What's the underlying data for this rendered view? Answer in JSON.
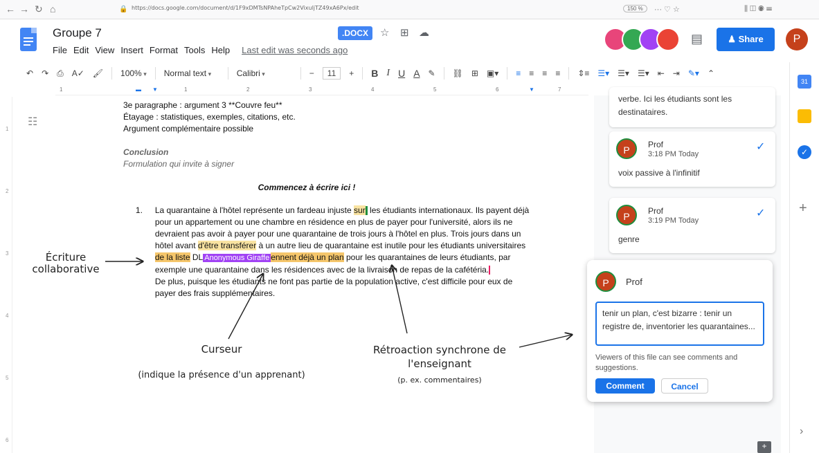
{
  "browser": {
    "url": "https://docs.google.com/document/d/1F9xDMTsNPAheTpCw2VixuljTZ49xA6Px/edit",
    "zoom": "150 %"
  },
  "header": {
    "title": "Groupe 7",
    "badge": ".DOCX",
    "menu": [
      "File",
      "Edit",
      "View",
      "Insert",
      "Format",
      "Tools",
      "Help"
    ],
    "last_edit": "Last edit was seconds ago",
    "share_label": "Share",
    "user_initial": "P"
  },
  "toolbar": {
    "zoom": "100%",
    "style": "Normal text",
    "font": "Calibri",
    "size": "11"
  },
  "ruler": [
    "1",
    "1",
    "2",
    "3",
    "4",
    "5",
    "6",
    "7"
  ],
  "vruler": [
    "1",
    "2",
    "3",
    "4",
    "5",
    "6"
  ],
  "doc": {
    "line1": "3e paragraphe : argument 3 **Couvre feu**",
    "line2": "Étayage : statistiques, exemples, citations, etc.",
    "line3": "Argument complémentaire possible",
    "conclusion": "Conclusion",
    "formulation": "Formulation qui invite à signer",
    "start_here": "Commencez à écrire ici !",
    "item_number": "1.",
    "p1_a": "La quarantaine à l'hôtel représente un fardeau injuste ",
    "p1_sur": "sur",
    "p1_b": " les étudiants internationaux. Ils payent déjà pour un appartement ou une chambre en résidence en plus de payer pour l'université, alors ils ne devraient pas avoir à payer pour une quarantaine de trois jours à l'hôtel en plus. Trois jours dans un hôtel avant ",
    "p1_transf": "d'être transférer",
    "p1_c": " à un autre lieu de quarantaine est inutile pour les étudiants universitaires ",
    "p1_liste": "de la liste",
    "p1_dl": " DL",
    "giraffe": "Anonymous Giraffe",
    "p1_plan": "ennent déjà un plan",
    "p1_d": " pour les quarantaines de leurs étudiants, par exemple une quarantaine dans les résidences avec de la livraison de repas de la cafétéria.",
    "p2": "De plus, puisque les étudiants ne font pas partie de la population active, c'est difficile pour eux de payer des frais supplémentaires."
  },
  "annotations": {
    "ecriture": "Écriture collaborative",
    "curseur": "Curseur",
    "curseur_sub": "(indique la présence d'un apprenant)",
    "retro": "Rétroaction synchrone de l'enseignant",
    "retro_sub": "(p. ex. commentaires)"
  },
  "comments": {
    "partial": "verbe. Ici les étudiants sont les destinataires.",
    "c1": {
      "name": "Prof",
      "time": "3:18 PM Today",
      "text": "voix passive à l'infinitif"
    },
    "c2": {
      "name": "Prof",
      "time": "3:19 PM Today",
      "text": "genre"
    },
    "new": {
      "name": "Prof",
      "draft": "tenir un plan, c'est bizarre : tenir un registre de, inventorier les quarantaines...",
      "notice": "Viewers of this file can see comments and suggestions.",
      "comment_label": "Comment",
      "cancel_label": "Cancel"
    }
  }
}
